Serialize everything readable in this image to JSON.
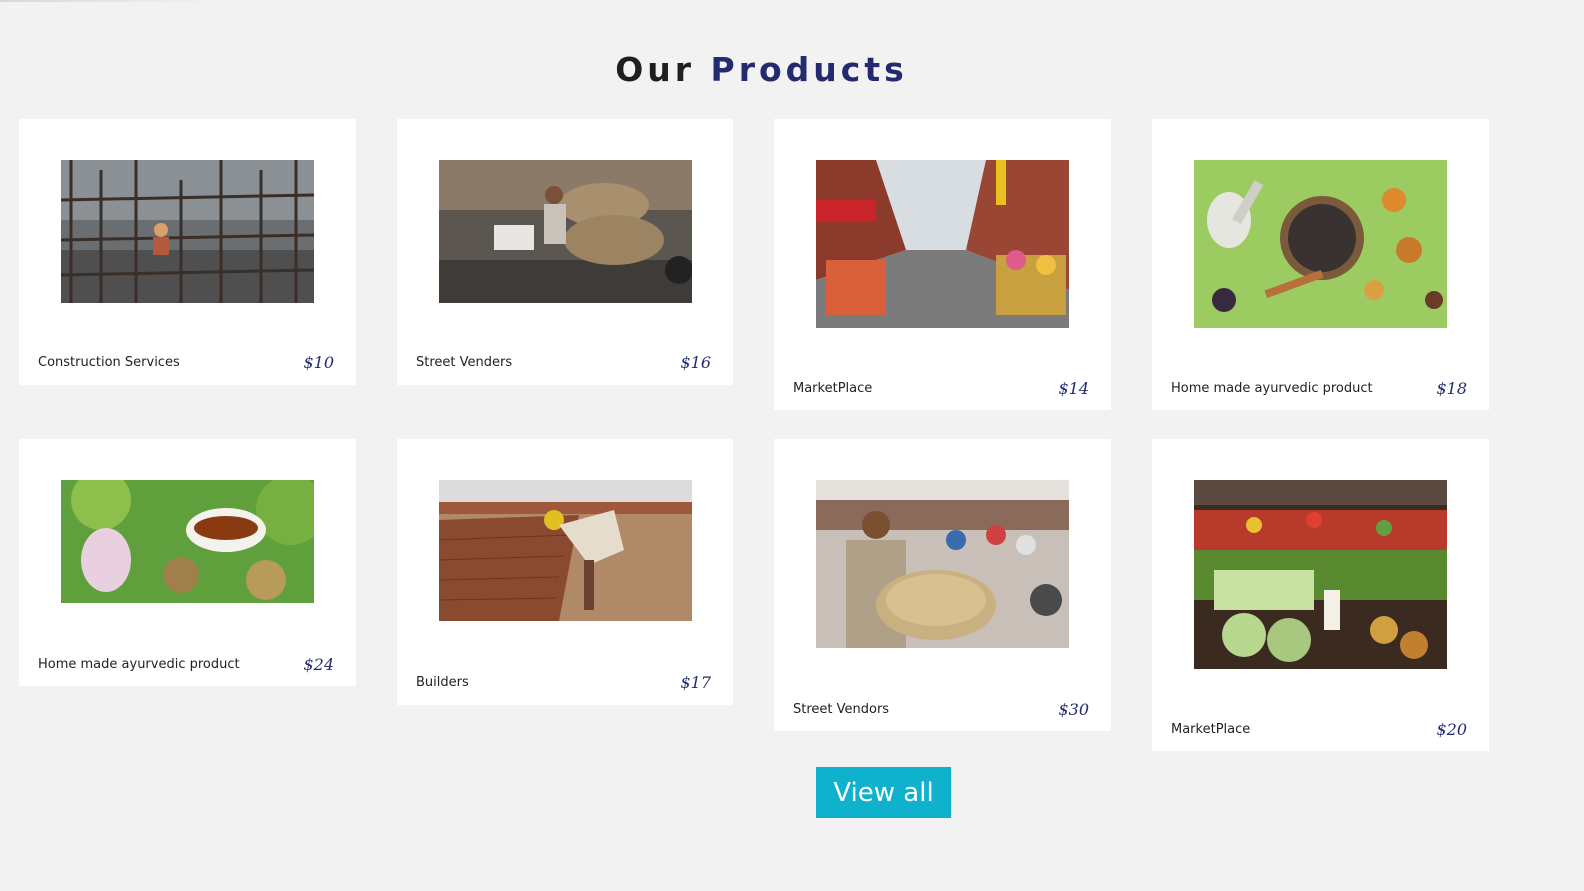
{
  "section": {
    "title_main": "Our",
    "title_accent": "Products"
  },
  "products": [
    {
      "name": "Construction Services",
      "price": "$10",
      "image_alt": "construction-site-photo"
    },
    {
      "name": "Street Venders",
      "price": "$16",
      "image_alt": "street-vendor-carrying-sacks-photo"
    },
    {
      "name": "MarketPlace",
      "price": "$14",
      "image_alt": "street-market-photo"
    },
    {
      "name": "Home made ayurvedic product",
      "price": "$18",
      "image_alt": "ayurvedic-spices-photo"
    },
    {
      "name": "Home made ayurvedic product",
      "price": "$24",
      "image_alt": "ayurvedic-herbal-oil-photo"
    },
    {
      "name": "Builders",
      "price": "$17",
      "image_alt": "brick-maker-photo"
    },
    {
      "name": "Street Vendors",
      "price": "$30",
      "image_alt": "street-vendor-crowd-photo"
    },
    {
      "name": "MarketPlace",
      "price": "$20",
      "image_alt": "vegetable-market-photo"
    }
  ],
  "actions": {
    "view_all_label": "View all"
  },
  "colors": {
    "background": "#f2f2f2",
    "accent": "#232a6e",
    "button": "#0fb1cc"
  }
}
